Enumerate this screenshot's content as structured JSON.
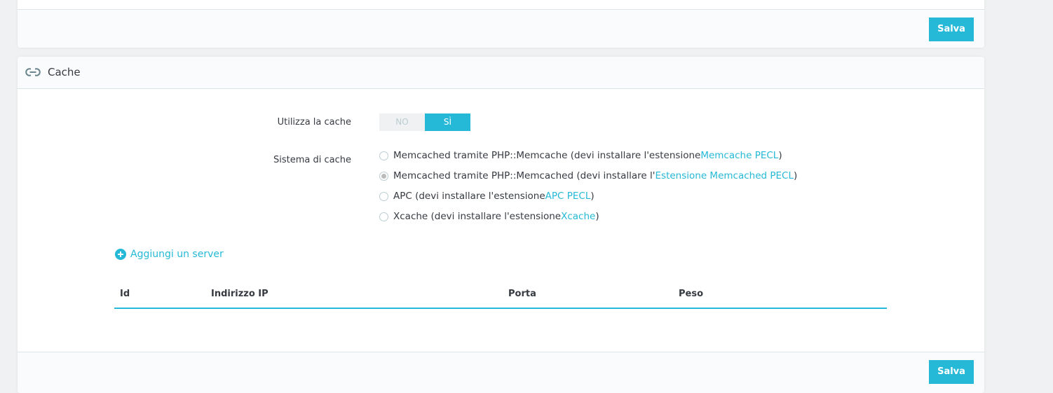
{
  "top_panel": {
    "save_label": "Salva"
  },
  "cache_panel": {
    "heading_icon": "link-icon",
    "title": "Cache",
    "use_cache": {
      "label": "Utilizza la cache",
      "off_label": "NO",
      "on_label": "SÌ",
      "value": "SÌ"
    },
    "cache_system": {
      "label": "Sistema di cache",
      "options": [
        {
          "text": "Memcached tramite PHP::Memcache (devi installare l'estensione ",
          "link": "Memcache PECL",
          "suffix": " )",
          "checked": false
        },
        {
          "text": "Memcached tramite PHP::Memcached (devi installare l'",
          "link": "Estensione Memcached PECL",
          "suffix": ")",
          "checked": true
        },
        {
          "text": "APC (devi installare l'estensione ",
          "link": "APC PECL",
          "suffix": " )",
          "checked": false
        },
        {
          "text": "Xcache (devi installare l'estensione ",
          "link": "Xcache",
          "suffix": " )",
          "checked": false
        }
      ]
    },
    "add_server_label": "Aggiungi un server",
    "table_headers": [
      "Id",
      "Indirizzo IP",
      "Porta",
      "Peso"
    ],
    "save_label": "Salva"
  },
  "colors": {
    "accent": "#25b9d7",
    "background": "#eff1f2",
    "text": "#363a41"
  }
}
